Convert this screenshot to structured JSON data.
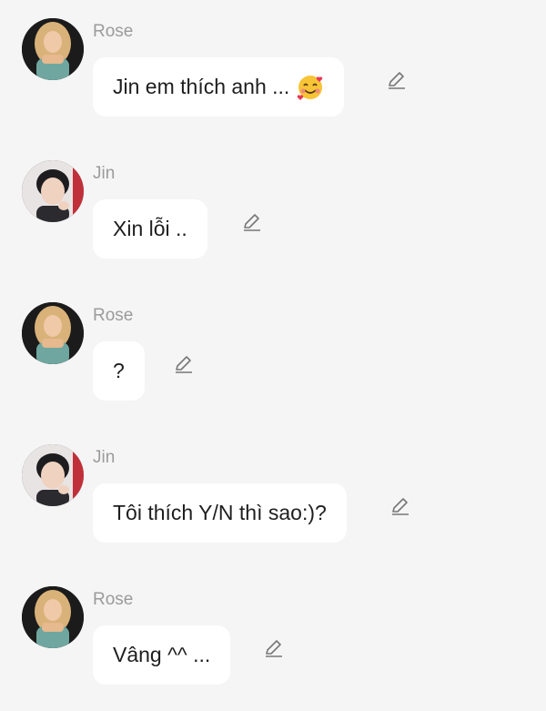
{
  "messages": [
    {
      "sender": "Rose",
      "text": "Jin em thích anh ...",
      "emoji": "smiling-face-with-hearts",
      "avatar": "rose-avatar"
    },
    {
      "sender": "Jin",
      "text": "Xin lỗi ..",
      "avatar": "jin-avatar"
    },
    {
      "sender": "Rose",
      "text": "?",
      "avatar": "rose-avatar"
    },
    {
      "sender": "Jin",
      "text": "Tôi thích Y/N thì sao:)?",
      "avatar": "jin-avatar"
    },
    {
      "sender": "Rose",
      "text": "Vâng ^^ ...",
      "avatar": "rose-avatar"
    }
  ],
  "icons": {
    "edit": "pencil-icon"
  },
  "colors": {
    "background": "#f5f5f5",
    "bubble": "#ffffff",
    "sender_name": "#9b9b9b",
    "message_text": "#1e1e1e"
  }
}
